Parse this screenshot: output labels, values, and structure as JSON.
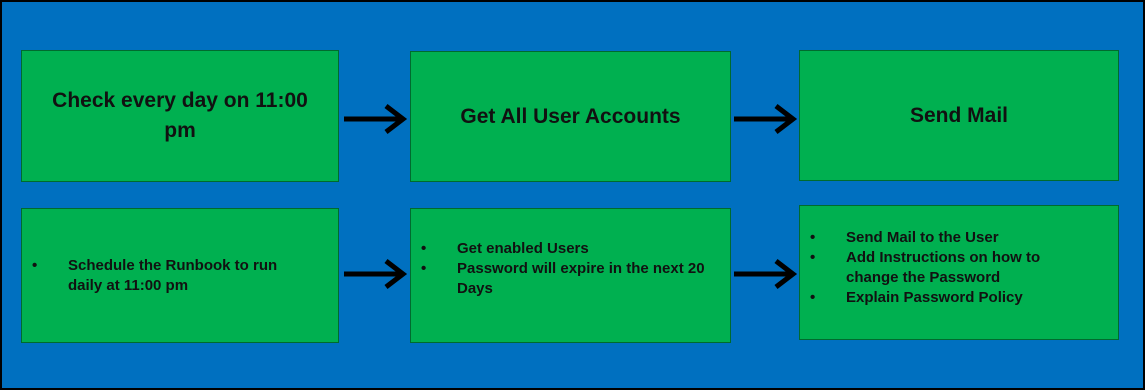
{
  "colors": {
    "background": "#0070c0",
    "box_fill": "#00b050",
    "arrow": "#000000",
    "text": "#111111"
  },
  "steps": [
    {
      "title": "Check every day on 11:00 pm",
      "details": [
        "Schedule the Runbook to run daily at 11:00 pm"
      ]
    },
    {
      "title": "Get All User Accounts",
      "details": [
        "Get enabled Users",
        "Password will expire in the next 20 Days"
      ]
    },
    {
      "title": "Send Mail",
      "details": [
        "Send Mail to the User",
        "Add Instructions on how to change the Password",
        "Explain Password Policy"
      ]
    }
  ],
  "arrow_icon": "right-arrow-icon"
}
